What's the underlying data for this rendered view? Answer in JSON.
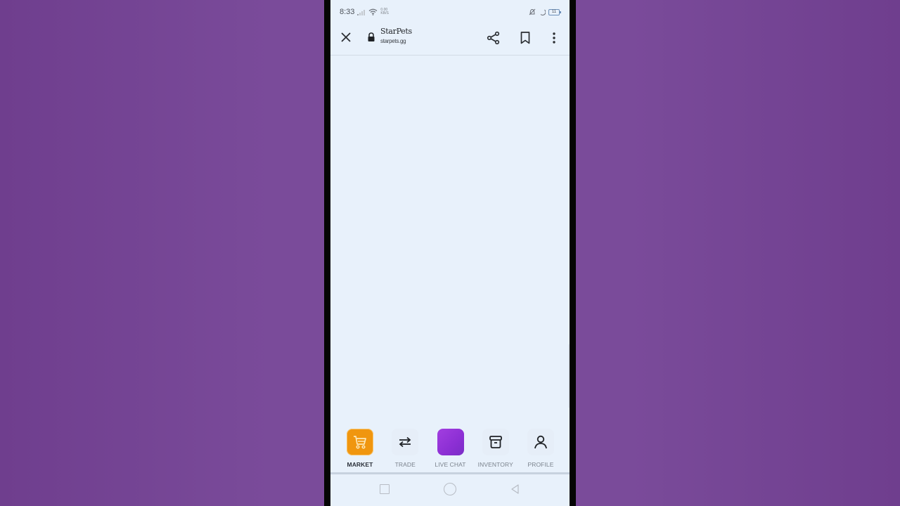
{
  "status_bar": {
    "time": "8:33",
    "net_speed_value": "0.00",
    "net_speed_unit": "KB/S",
    "battery_level": "11"
  },
  "toolbar": {
    "site_title": "StarPets",
    "site_url": "starpets.gg",
    "icons": {
      "close": "close-icon",
      "lock": "lock-icon",
      "share": "share-icon",
      "bookmark": "bookmark-icon",
      "more": "more-vert-icon"
    }
  },
  "bottom_nav": {
    "items": [
      {
        "label": "MARKET",
        "icon": "cart-icon",
        "active": true,
        "accent": "#f0960f"
      },
      {
        "label": "TRADE",
        "icon": "swap-arrows-icon",
        "active": false
      },
      {
        "label": "LIVE CHAT",
        "icon": "live-chat-icon",
        "active": false,
        "accent": "#9a36dc"
      },
      {
        "label": "INVENTORY",
        "icon": "archive-box-icon",
        "active": false
      },
      {
        "label": "PROFILE",
        "icon": "user-icon",
        "active": false
      }
    ]
  },
  "android_nav": {
    "recent": "recent-apps-icon",
    "home": "home-icon",
    "back": "back-icon"
  },
  "colors": {
    "background": "#7a4b9a",
    "screen": "#e8f1fb",
    "market_accent": "#f0960f",
    "live_chat_accent": "#9a36dc"
  }
}
